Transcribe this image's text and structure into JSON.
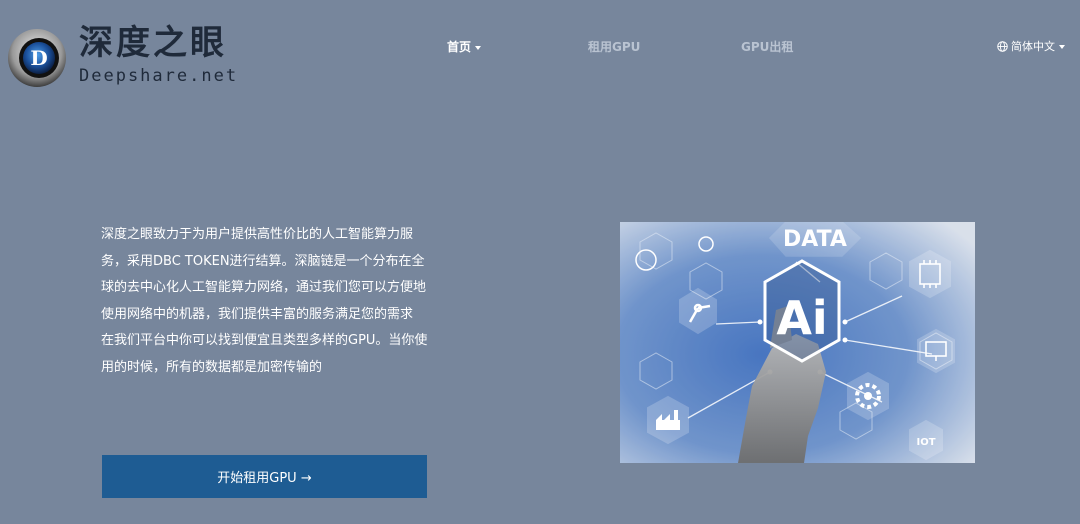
{
  "brand": {
    "title": "深度之眼",
    "subtitle": "Deepshare.net",
    "logo_letter": "D"
  },
  "nav": {
    "items": [
      {
        "label": "首页"
      },
      {
        "label": "租用GPU"
      },
      {
        "label": "GPU出租"
      }
    ],
    "language": {
      "label": "简体中文",
      "icon": "globe-icon"
    }
  },
  "hero": {
    "paragraph1": "深度之眼致力于为用户提供高性价比的人工智能算力服务，采用DBC TOKEN进行结算。深脑链是一个分布在全球的去中心化人工智能算力网络，通过我们您可以方便地使用网络中的机器，我们提供丰富的服务满足您的需求",
    "paragraph2": "在我们平台中你可以找到便宜且类型多样的GPU。当你使用的时候，所有的数据都是加密传输的",
    "cta_label": "开始租用GPU →"
  },
  "illustration": {
    "center_label": "Ai",
    "top_label": "DATA",
    "iot_label": "IOT"
  },
  "colors": {
    "background": "#77869c",
    "button": "#1e5c93",
    "nav_inactive": "#b9c3d1",
    "logo_text": "#1f2a3a"
  }
}
